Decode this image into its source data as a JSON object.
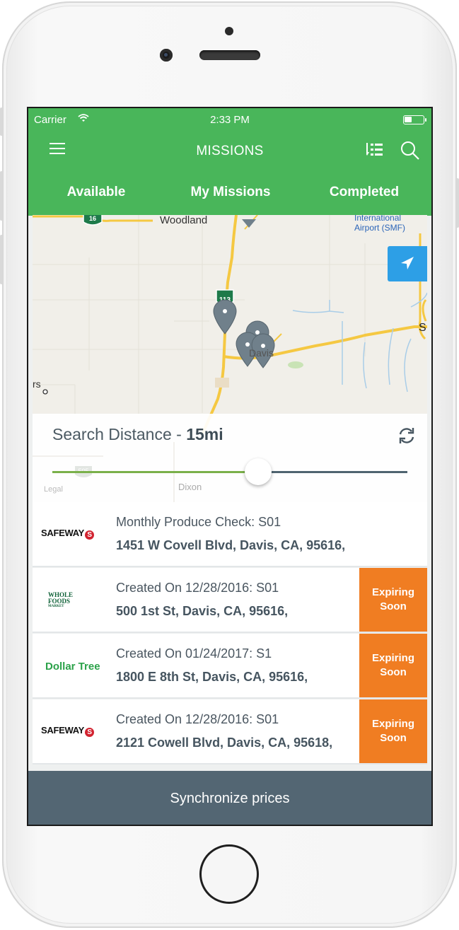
{
  "status_bar": {
    "carrier": "Carrier",
    "time": "2:33 PM"
  },
  "header": {
    "title": "MISSIONS",
    "menu_icon": "hamburger-menu-icon",
    "list_icon": "list-view-icon",
    "search_icon": "search-icon"
  },
  "tabs": [
    {
      "label": "Available"
    },
    {
      "label": "My Missions"
    },
    {
      "label": "Completed"
    }
  ],
  "map": {
    "labels": {
      "woodland": "Woodland",
      "airport_line1": "International",
      "airport_line2": "Airport (SMF)",
      "davis": "Davis",
      "dixon": "Dixon",
      "hwy113": "113",
      "hwy16": "16",
      "hwy505": "505",
      "s": "S",
      "rs": "rs",
      "legal": "Legal"
    },
    "locate_button_icon": "navigation-arrow-icon"
  },
  "search_distance": {
    "label": "Search Distance - ",
    "value": "15mi",
    "slider_fraction": 0.58,
    "refresh_icon": "refresh-icon"
  },
  "missions": [
    {
      "store": "safeway",
      "logo_text": "SAFEWAY",
      "title": "Monthly Produce Check: S01",
      "address": "1451 W Covell Blvd, Davis, CA, 95616,",
      "badge": ""
    },
    {
      "store": "whole-foods",
      "logo_text_1": "WHOLE",
      "logo_text_2": "FOODS",
      "logo_text_3": "MARKET",
      "title": "Created On 12/28/2016: S01",
      "address": "500 1st St, Davis, CA, 95616,",
      "badge": "Expiring Soon"
    },
    {
      "store": "dollar-tree",
      "logo_text": "Dollar Tree",
      "title": "Created On 01/24/2017: S1",
      "address": "1800 E 8th St, Davis, CA, 95616,",
      "badge": "Expiring Soon"
    },
    {
      "store": "safeway",
      "logo_text": "SAFEWAY",
      "title": "Created On 12/28/2016: S01",
      "address": "2121 Cowell Blvd, Davis, CA, 95618,",
      "badge": "Expiring Soon"
    }
  ],
  "footer": {
    "sync_label": "Synchronize prices"
  },
  "colors": {
    "header_green": "#49b65a",
    "badge_orange": "#f07d22",
    "footer_slate": "#536673",
    "locate_blue": "#2d9fe6"
  }
}
